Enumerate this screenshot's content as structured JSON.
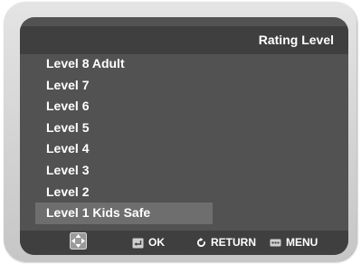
{
  "header": {
    "title": "Rating Level"
  },
  "menu": {
    "items": [
      {
        "label": "Level 8 Adult"
      },
      {
        "label": "Level 7"
      },
      {
        "label": "Level 6"
      },
      {
        "label": "Level 5"
      },
      {
        "label": "Level 4"
      },
      {
        "label": "Level 3"
      },
      {
        "label": "Level 2"
      },
      {
        "label": "Level 1 Kids Safe"
      }
    ],
    "selected_index": 7
  },
  "footer": {
    "nav_icon": "dpad-icon",
    "ok_icon": "enter-icon",
    "ok_label": "OK",
    "return_icon": "return-icon",
    "return_label": "RETURN",
    "menu_icon": "menu-icon",
    "menu_label": "MENU"
  },
  "colors": {
    "screen_bg": "#525252",
    "bar_bg": "#3f3f3f",
    "highlight": "#6e6e6e",
    "text": "#ffffff"
  }
}
